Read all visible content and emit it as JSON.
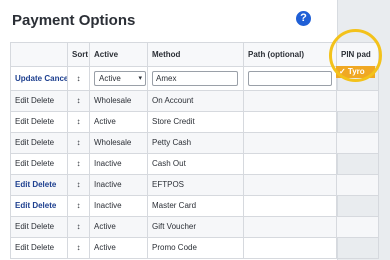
{
  "page": {
    "title": "Payment Options",
    "help_icon": "?"
  },
  "table": {
    "columns": [
      "",
      "Sort",
      "Active",
      "Method",
      "Path (optional)",
      "PIN pad"
    ],
    "sort_glyph": "↕",
    "edit_row": {
      "actions": "Update Cancel",
      "active_value": "Active",
      "method_value": "Amex",
      "path_value": "",
      "pin_selected": "✓ Tyro"
    },
    "rows": [
      {
        "actions": "Edit Delete",
        "active": "Wholesale",
        "method": "On Account",
        "blue": false
      },
      {
        "actions": "Edit Delete",
        "active": "Active",
        "method": "Store Credit",
        "blue": false
      },
      {
        "actions": "Edit Delete",
        "active": "Wholesale",
        "method": "Petty Cash",
        "blue": false
      },
      {
        "actions": "Edit Delete",
        "active": "Inactive",
        "method": "Cash Out",
        "blue": false
      },
      {
        "actions": "Edit Delete",
        "active": "Inactive",
        "method": "EFTPOS",
        "blue": true
      },
      {
        "actions": "Edit Delete",
        "active": "Inactive",
        "method": "Master Card",
        "blue": true
      },
      {
        "actions": "Edit Delete",
        "active": "Active",
        "method": "Gift Voucher",
        "blue": false
      },
      {
        "actions": "Edit Delete",
        "active": "Active",
        "method": "Promo Code",
        "blue": false
      }
    ]
  },
  "colors": {
    "accent": "#1f5fd6",
    "highlight_ring": "#f3c21b",
    "dropdown_selected": "#f0a823"
  }
}
